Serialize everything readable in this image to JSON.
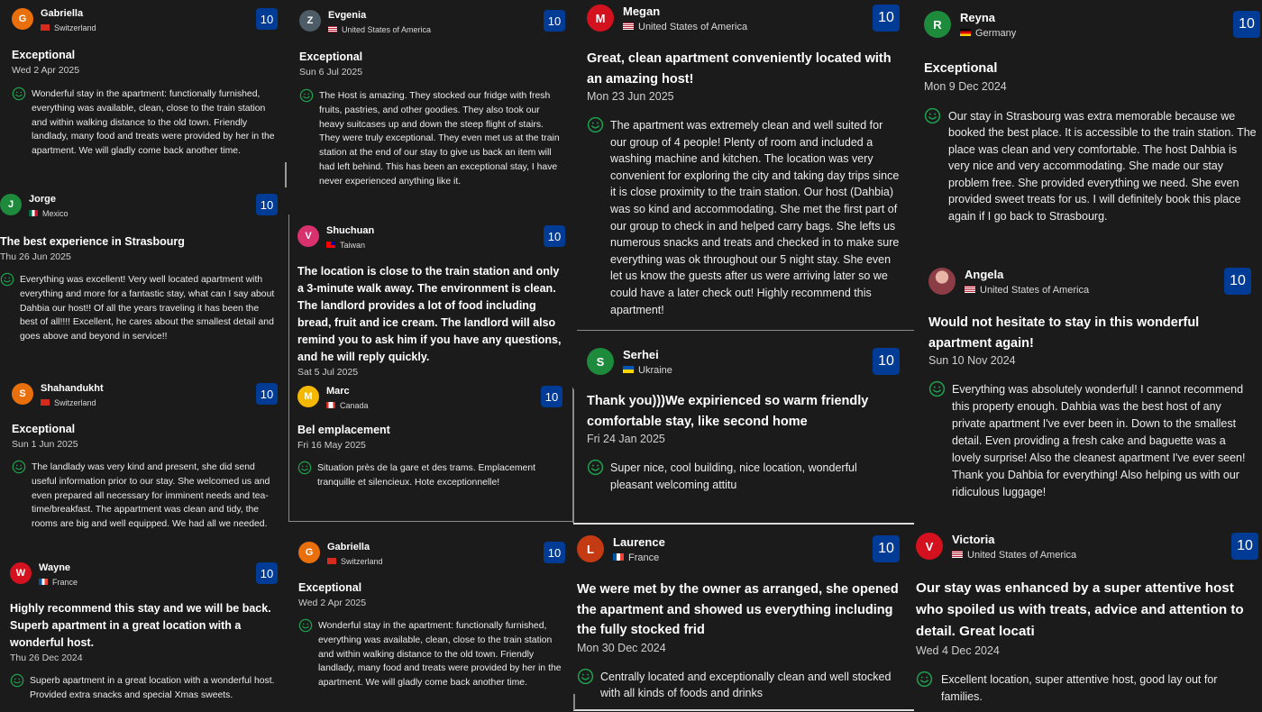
{
  "colors": {
    "background": "#1b1b1b",
    "score_badge": "#003b95",
    "smile_icon": "#1f9e4d"
  },
  "columns": [
    {
      "reviews": [
        {
          "name": "Gabriella",
          "initial": "G",
          "avatar_color": "#e96f0c",
          "country": "Switzerland",
          "flag": "ch",
          "score": "10",
          "title": "Exceptional",
          "date": "Wed 2 Apr 2025",
          "body": "Wonderful stay in the apartment: functionally furnished, everything was available, clean, close to the train station and within walking distance to the old town. Friendly landlady, many food and treats were provided by her in the apartment. We will gladly come back another time."
        },
        {
          "name": "Jorge",
          "initial": "J",
          "avatar_color": "#1e8a3c",
          "country": "Mexico",
          "flag": "mx",
          "score": "10",
          "title": "The best experience in Strasbourg",
          "date": "Thu 26 Jun 2025",
          "body": "Everything was excellent! Very well located apartment with everything and more for a fantastic stay, what can I say about Dahbia our host!! Of all the years traveling it has been the best of all!!!! Excellent, he cares about the smallest detail and goes above and beyond in service!!"
        },
        {
          "name": "Shahandukht",
          "initial": "S",
          "avatar_color": "#e96f0c",
          "country": "Switzerland",
          "flag": "ch",
          "score": "10",
          "title": "Exceptional",
          "date": "Sun 1 Jun 2025",
          "body": "The landlady was very kind and present, she did send useful information prior to our stay. She welcomed us and even prepared all necessary for imminent needs and tea-time/breakfast. The appartment was clean and tidy, the rooms are big and well equipped. We had all we needed."
        },
        {
          "name": "Wayne",
          "initial": "W",
          "avatar_color": "#d4111e",
          "country": "France",
          "flag": "fr",
          "score": "10",
          "title": "Highly recommend this stay and we will be back. Superb apartment in a great location with a wonderful host.",
          "date": "Thu 26 Dec 2024",
          "body": "Superb apartment in a great location with a wonderful host. Provided extra snacks and special Xmas sweets."
        }
      ]
    },
    {
      "reviews": [
        {
          "name": "Evgenia",
          "initial": "Z",
          "avatar_color": "#4d5c66",
          "country": "United States of America",
          "flag": "us",
          "score": "10",
          "title": "Exceptional",
          "date": "Sun 6 Jul 2025",
          "body": "The Host is amazing. They stocked our fridge with fresh fruits, pastries, and other goodies. They also took our heavy suitcases up and down the steep flight of stairs. They were truly exceptional. They even met us at the train station at the end of our stay to give us back an item will had left behind. This has been an exceptional stay, I have never experienced anything like it."
        },
        {
          "name": "Shuchuan",
          "initial": "V",
          "avatar_color": "#d8316d",
          "country": "Taiwan",
          "flag": "tw",
          "score": "10",
          "title": "The location is close to the train station and only a 3-minute walk away. The environment is clean. The landlord provides a lot of food including bread, fruit and ice cream. The landlord will also remind you to ask him if you have any questions, and he will reply quickly.",
          "date": "Sat 5 Jul 2025",
          "body": ""
        },
        {
          "name": "Marc",
          "initial": "M",
          "avatar_color": "#f5b800",
          "country": "Canada",
          "flag": "ca",
          "score": "10",
          "title": "Bel emplacement",
          "date": "Fri 16 May 2025",
          "body": "Situation près de la gare et des trams. Emplacement tranquille et silencieux. Hote exceptionnelle!"
        },
        {
          "name": "Gabriella",
          "initial": "G",
          "avatar_color": "#e96f0c",
          "country": "Switzerland",
          "flag": "ch",
          "score": "10",
          "title": "Exceptional",
          "date": "Wed 2 Apr 2025",
          "body": "Wonderful stay in the apartment: functionally furnished, everything was available, clean, close to the train station and within walking distance to the old town. Friendly landlady, many food and treats were provided by her in the apartment. We will gladly come back another time."
        }
      ]
    },
    {
      "reviews": [
        {
          "name": "Megan",
          "initial": "M",
          "avatar_color": "#d4111e",
          "country": "United States of America",
          "flag": "us",
          "score": "10",
          "title": "Great, clean apartment conveniently located with an amazing host!",
          "date": "Mon 23 Jun 2025",
          "body": "The apartment was extremely clean and well suited for our group of 4 people! Plenty of room and included a washing machine and kitchen. The location was very convenient for exploring the city and taking day trips since it is close proximity to the train station. Our host (Dahbia) was so kind and accommodating. She met the first part of our group to check in and helped carry bags. She lefts us numerous snacks and treats and checked in to make sure everything was ok throughout our 5 night stay. She even let us know the guests after us were arriving later so we could have a later check out! Highly recommend this apartment!"
        },
        {
          "name": "Serhei",
          "initial": "S",
          "avatar_color": "#1e8a3c",
          "country": "Ukraine",
          "flag": "ua",
          "score": "10",
          "title": "Thank you)))We expirienced so warm friendly comfortable stay, like second home",
          "date": "Fri 24 Jan 2025",
          "body": "Super nice, cool building, nice location, wonderful pleasant welcoming attitu"
        },
        {
          "name": "Laurence",
          "initial": "L",
          "avatar_color": "#c43a12",
          "country": "France",
          "flag": "fr",
          "score": "10",
          "title": "We were met by the owner as arranged, she opened the apartment and showed us everything including the fully stocked frid",
          "date": "Mon 30 Dec 2024",
          "body": "Centrally located and exceptionally clean and well stocked with all kinds of foods and drinks"
        }
      ]
    },
    {
      "reviews": [
        {
          "name": "Reyna",
          "initial": "R",
          "avatar_color": "#1e8a3c",
          "country": "Germany",
          "flag": "de",
          "score": "10",
          "title": "Exceptional",
          "date": "Mon 9 Dec 2024",
          "body": "Our stay in Strasbourg was extra memorable because we booked the best place. It is accessible to the train station. The place was clean and very comfortable. The host Dahbia is very nice and very accommodating. She made our stay problem free. She provided everything we need. She even provided sweet treats for us. I will definitely book this place again if I go back to Strasbourg."
        },
        {
          "name": "Angela",
          "initial": "",
          "avatar_color": "#b0686a",
          "country": "United States of America",
          "flag": "us",
          "score": "10",
          "title": "Would not hesitate to stay in this wonderful apartment again!",
          "date": "Sun 10 Nov 2024",
          "body": "Everything was absolutely wonderful! I cannot recommend this property enough. Dahbia was the best host of any private apartment I've ever been in. Down to the smallest detail. Even providing a fresh cake and baguette was a lovely surprise! Also the cleanest apartment I've ever seen! Thank you Dahbia for everything! Also helping us with our ridiculous luggage!"
        },
        {
          "name": "Victoria",
          "initial": "V",
          "avatar_color": "#d4111e",
          "country": "United States of America",
          "flag": "us",
          "score": "10",
          "title": "Our stay was enhanced by a super attentive host who spoiled us with treats, advice and attention to detail. Great locati",
          "date": "Wed 4 Dec 2024",
          "body": "Excellent location, super attentive host, good lay out for families."
        }
      ]
    }
  ]
}
